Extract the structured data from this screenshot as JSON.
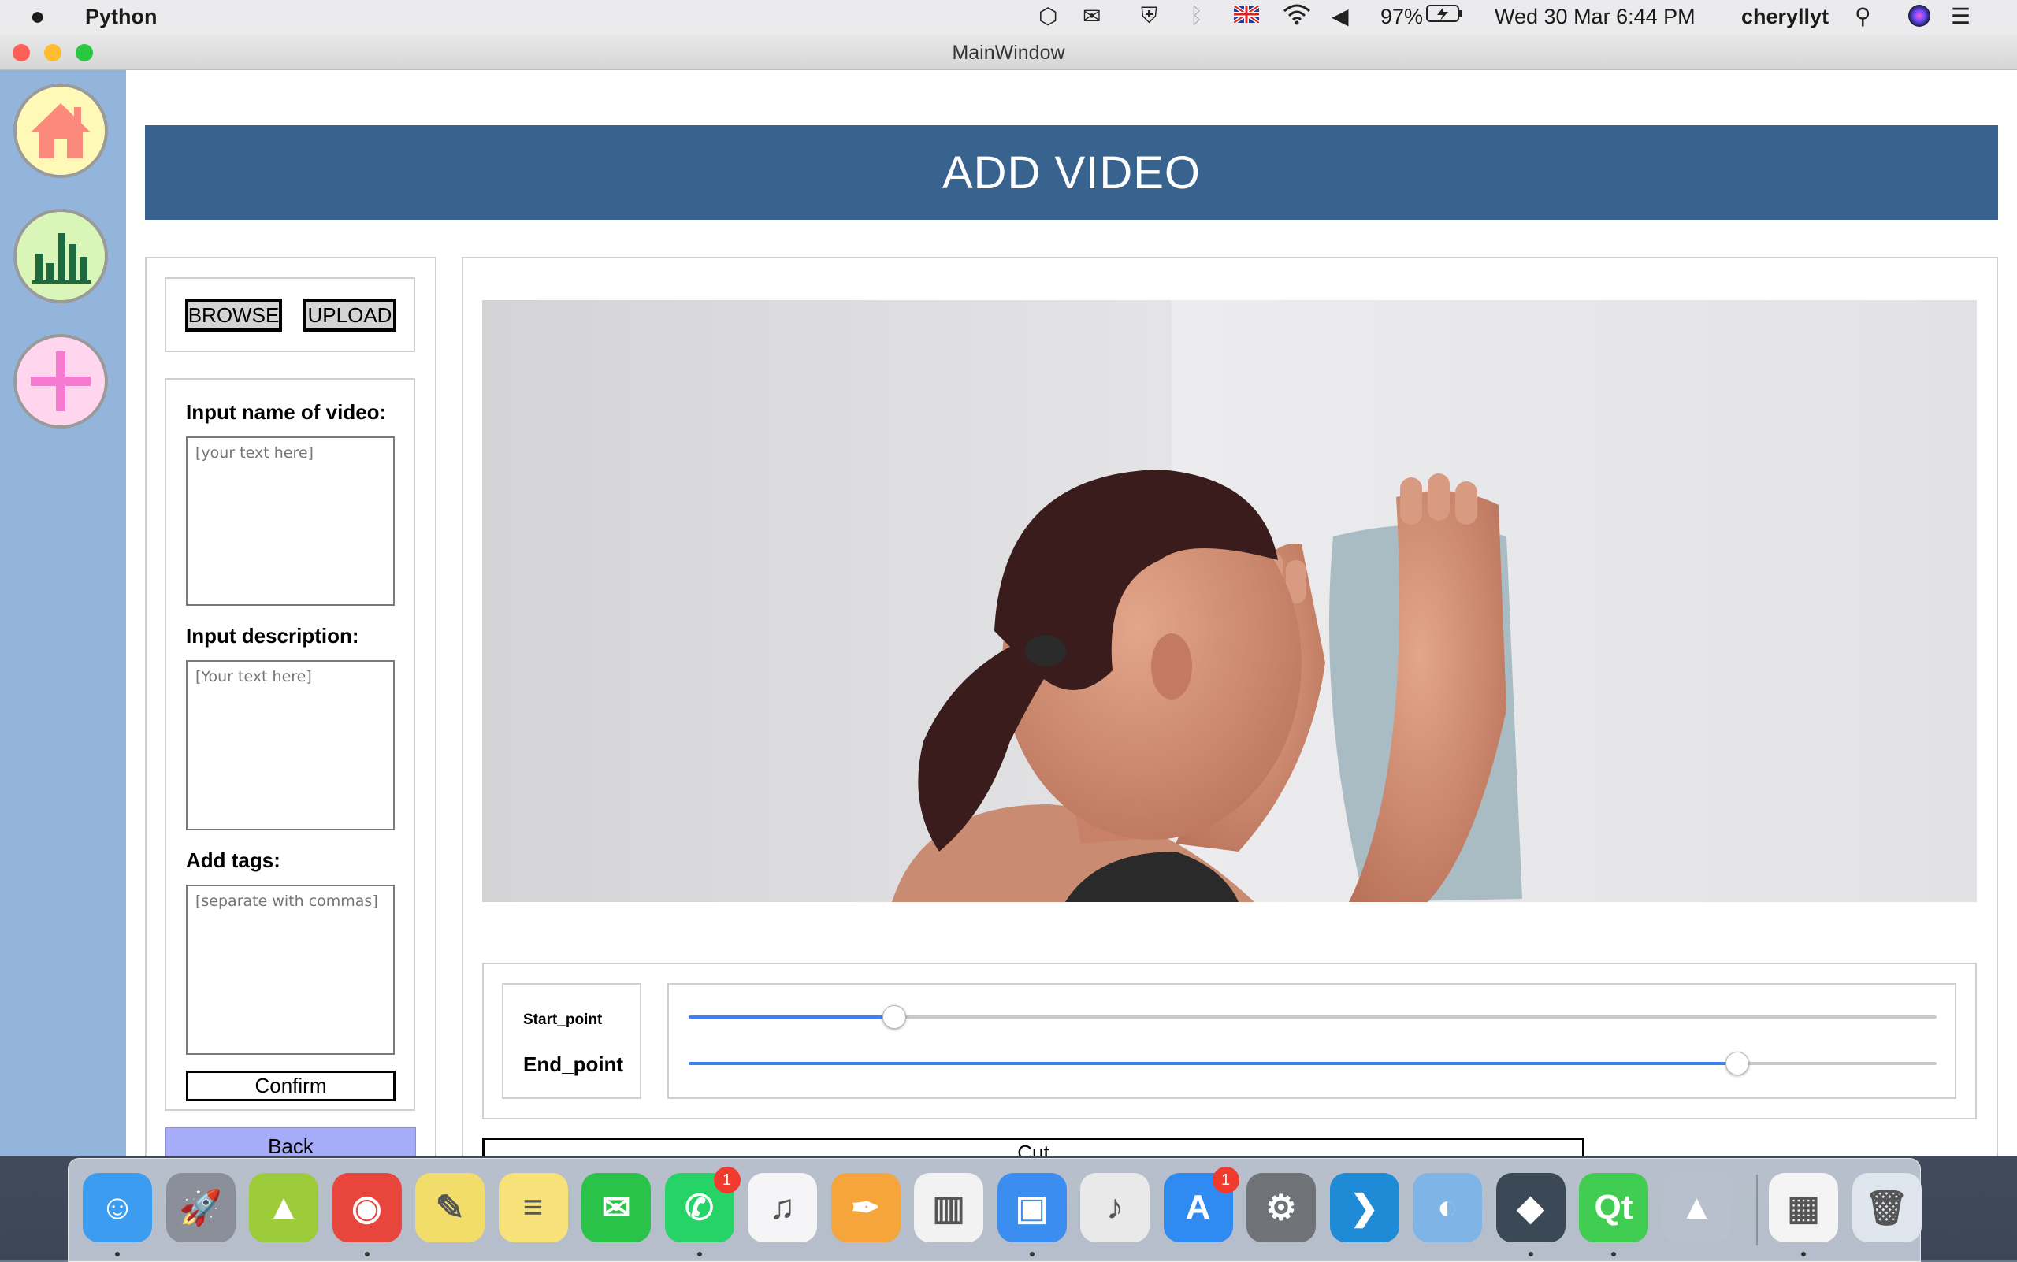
{
  "menubar": {
    "app_name": "Python",
    "battery": "97%",
    "datetime": "Wed 30 Mar  6:44 PM",
    "user": "cheryllyt",
    "icons": [
      "box-icon",
      "wechat-icon",
      "shield-icon",
      "bluetooth-icon",
      "uk-flag-icon",
      "wifi-icon",
      "volume-icon",
      "battery-icon",
      "spotlight-icon",
      "siri-icon",
      "control-center-icon"
    ]
  },
  "window": {
    "title": "MainWindow"
  },
  "sidebar": {
    "items": [
      {
        "name": "home",
        "icon": "house-icon",
        "color": "#fb8a7d",
        "bg": "#fff9b8"
      },
      {
        "name": "stats",
        "icon": "bar-chart-icon",
        "color": "#1e6a3e",
        "bg": "#d9f5b8"
      },
      {
        "name": "add",
        "icon": "plus-icon",
        "color": "#f57ad0",
        "bg": "#ffd6ee"
      }
    ]
  },
  "header": {
    "title": "ADD VIDEO",
    "color": "#37638e"
  },
  "left_panel": {
    "browse_label": "BROWSE",
    "upload_label": "UPLOAD",
    "name_label": "Input name of video:",
    "name_placeholder": "[your text here]",
    "description_label": "Input description:",
    "description_placeholder": "[Your text here]",
    "tags_label": "Add tags:",
    "tags_placeholder": "[separate with commas]",
    "confirm_label": "Confirm",
    "back_label": "Back"
  },
  "video_panel": {
    "start_label": "Start_point",
    "end_label": "End_point",
    "start_value": 0.165,
    "end_value": 0.84,
    "cut_label": "Cut",
    "accent": "#3a82f6"
  },
  "dock": {
    "apps": [
      {
        "name": "finder",
        "icon": "finder-icon",
        "glyph": "☺",
        "bg": "#3b9cf0"
      },
      {
        "name": "launchpad",
        "icon": "rocket-icon",
        "glyph": "🚀",
        "bg": "#8a8f99"
      },
      {
        "name": "android-file-transfer",
        "icon": "android-icon",
        "glyph": "▲",
        "bg": "#9ccc3a"
      },
      {
        "name": "chrome",
        "icon": "chrome-icon",
        "glyph": "◉",
        "bg": "#e8453c"
      },
      {
        "name": "stickies",
        "icon": "stickies-icon",
        "glyph": "✎",
        "bg": "#f3dd6a"
      },
      {
        "name": "notes",
        "icon": "notes-icon",
        "glyph": "≡",
        "bg": "#f7e27a"
      },
      {
        "name": "wechat",
        "icon": "wechat-icon",
        "glyph": "✉",
        "bg": "#2bc24a"
      },
      {
        "name": "whatsapp",
        "icon": "whatsapp-icon",
        "glyph": "✆",
        "bg": "#25d366",
        "badge": "1"
      },
      {
        "name": "music",
        "icon": "music-icon",
        "glyph": "♫",
        "bg": "#f5f5f7"
      },
      {
        "name": "pages",
        "icon": "pages-icon",
        "glyph": "✒",
        "bg": "#f6a53a"
      },
      {
        "name": "numbers",
        "icon": "numbers-icon",
        "glyph": "▥",
        "bg": "#f2f2f2"
      },
      {
        "name": "keynote",
        "icon": "keynote-icon",
        "glyph": "▣",
        "bg": "#3b8ef0"
      },
      {
        "name": "garageband",
        "icon": "guitar-icon",
        "glyph": "♪",
        "bg": "#e9e9e9"
      },
      {
        "name": "app-store",
        "icon": "app-store-icon",
        "glyph": "A",
        "bg": "#2f8bf2",
        "badge": "1"
      },
      {
        "name": "system-preferences",
        "icon": "gear-icon",
        "glyph": "⚙",
        "bg": "#6f7378"
      },
      {
        "name": "vscode",
        "icon": "vscode-icon",
        "glyph": "❯",
        "bg": "#1f8ad6"
      },
      {
        "name": "preview",
        "icon": "preview-icon",
        "glyph": "◐",
        "bg": "#7fb5e6"
      },
      {
        "name": "waves",
        "icon": "waves-icon",
        "glyph": "◆",
        "bg": "#3b4956"
      },
      {
        "name": "qt-creator",
        "icon": "qt-icon",
        "glyph": "Qt",
        "bg": "#41cd52"
      },
      {
        "name": "python-launcher",
        "icon": "python-rocket-icon",
        "glyph": "▲",
        "bg": "#b7c0cc"
      },
      {
        "name": "xlsx-file",
        "icon": "xlsx-file-icon",
        "glyph": "▦",
        "bg": "#f4f4f4"
      },
      {
        "name": "trash",
        "icon": "trash-icon",
        "glyph": "🗑",
        "bg": "#dfe5ec"
      }
    ]
  }
}
